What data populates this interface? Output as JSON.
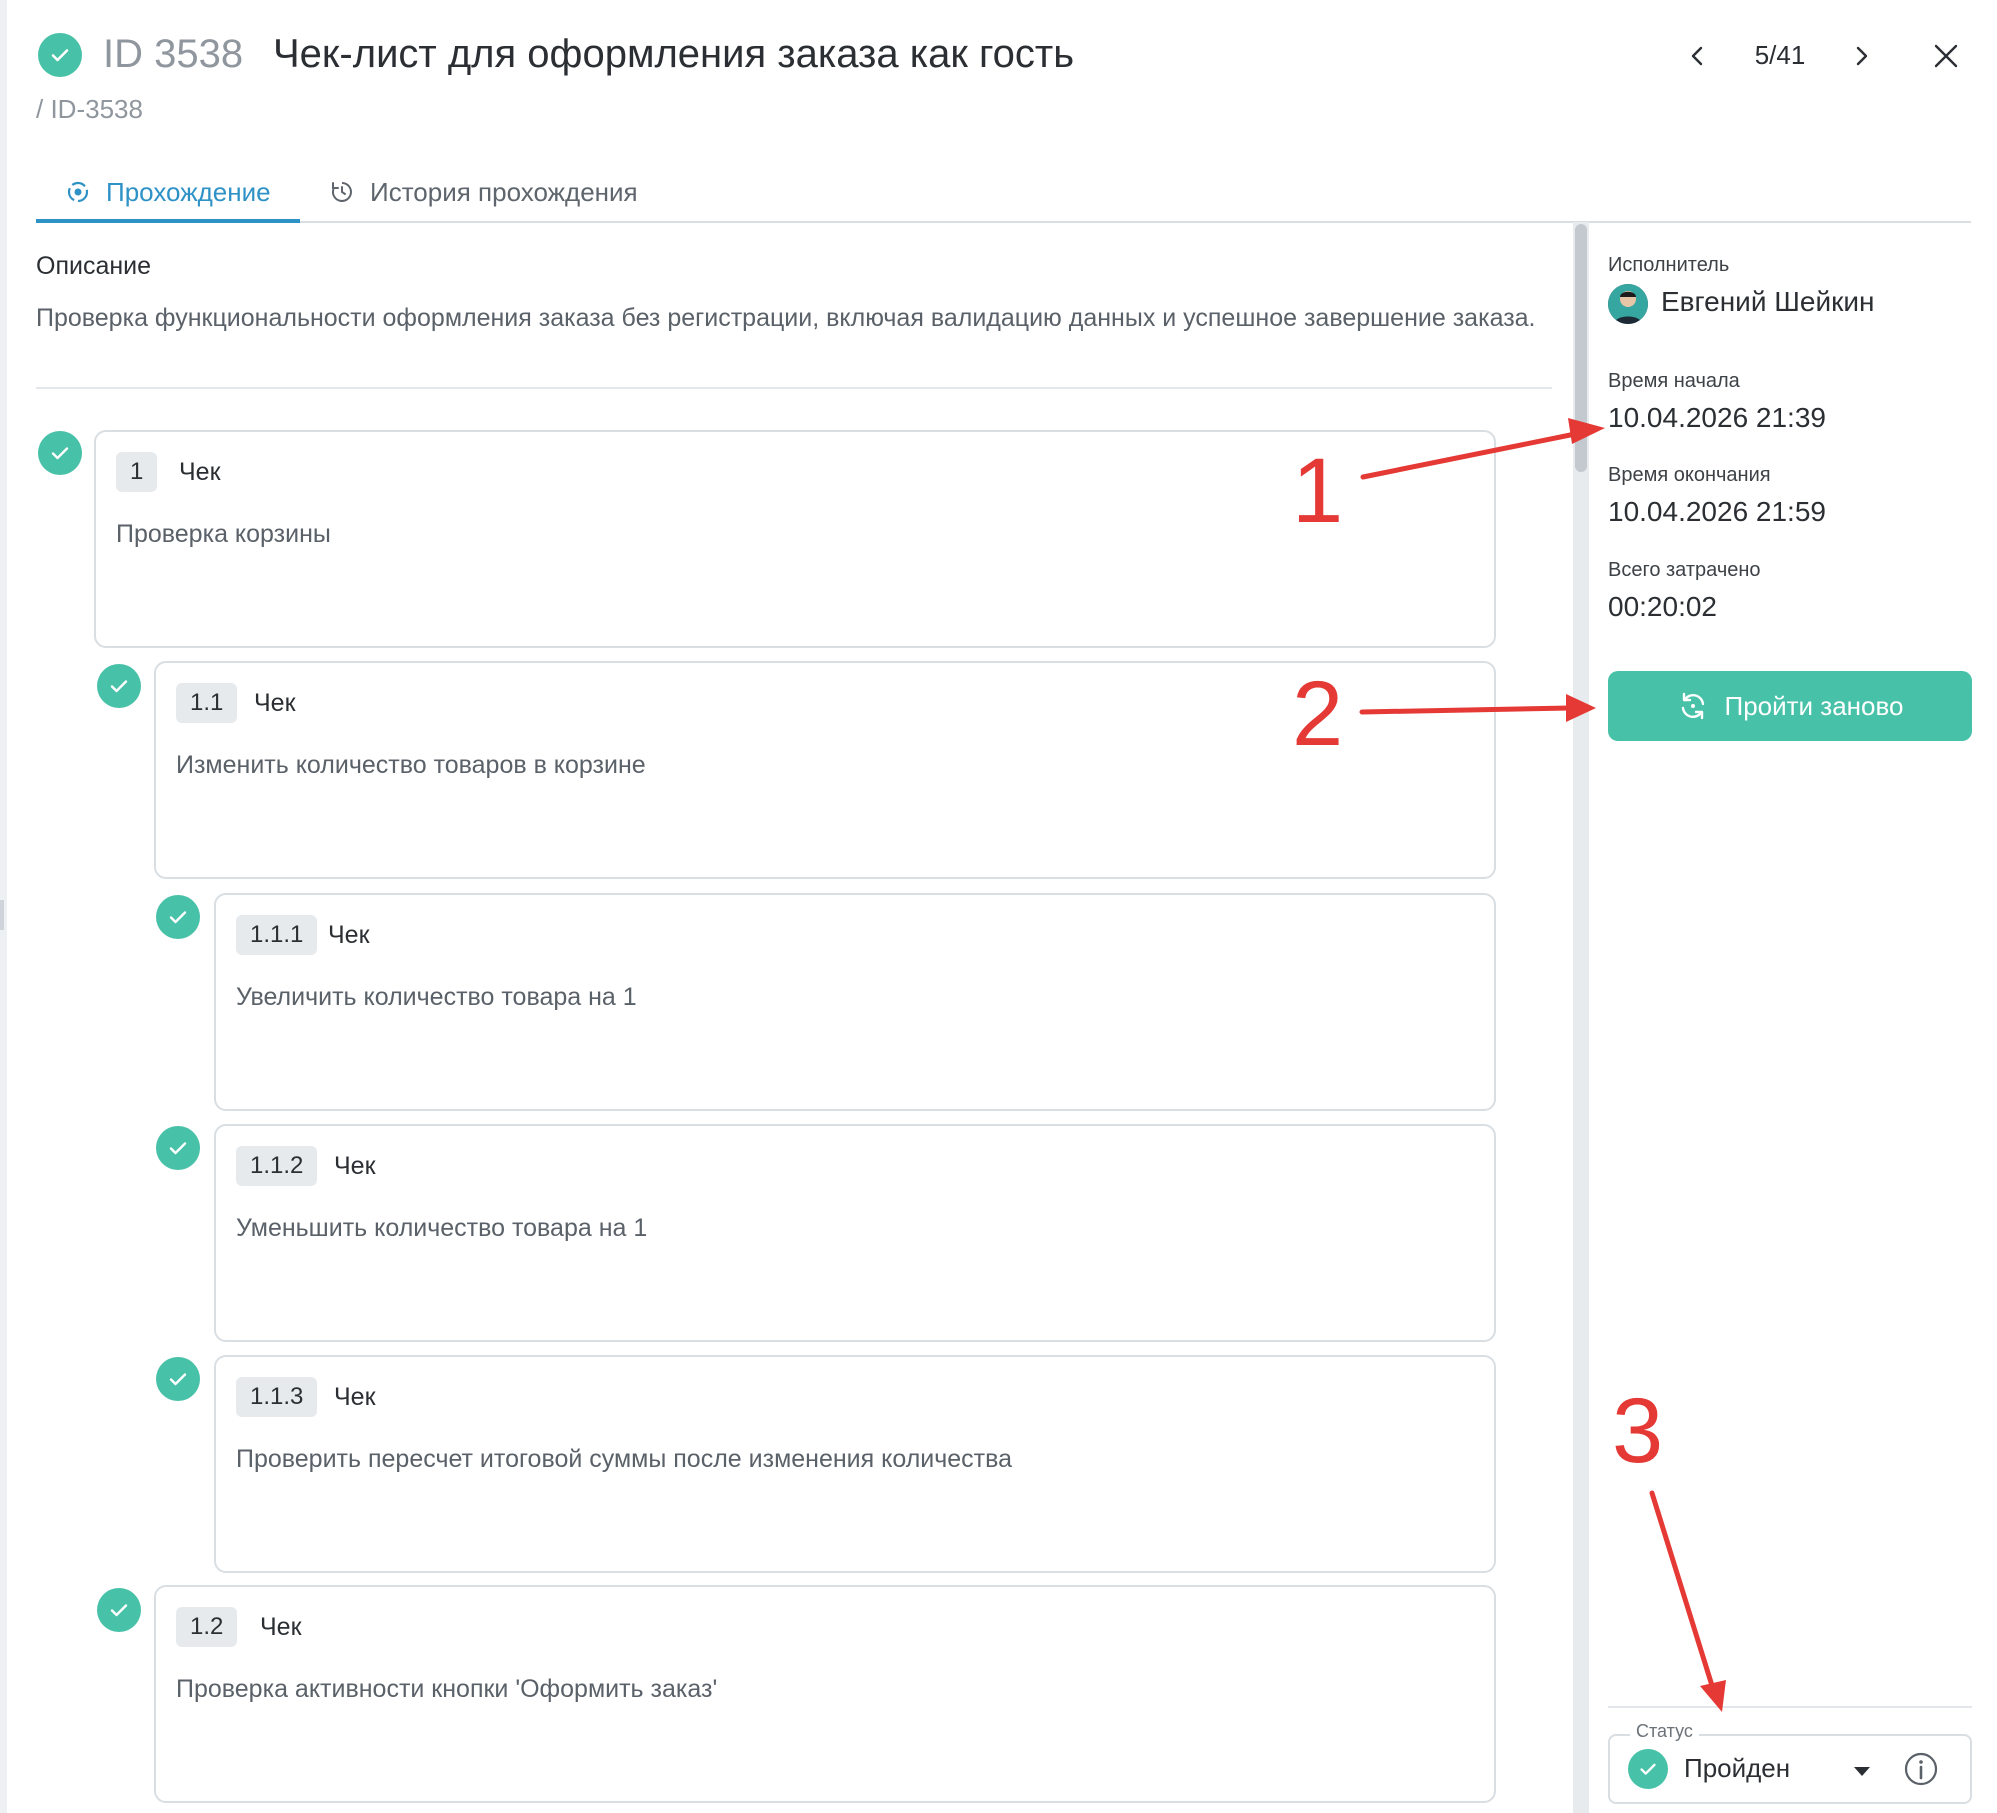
{
  "header": {
    "id": "ID 3538",
    "title": "Чек-лист для оформления заказа как гость",
    "breadcrumb": "/ ID-3538",
    "counter": "5/41"
  },
  "tabs": [
    {
      "label": "Прохождение",
      "icon": "run-icon",
      "active": true
    },
    {
      "label": "История прохождения",
      "icon": "history-icon",
      "active": false
    }
  ],
  "description": {
    "label": "Описание",
    "text": "Проверка функциональности оформления заказа без регистрации, включая валидацию данных и успешное завершение заказа."
  },
  "steps": [
    {
      "num": "1",
      "kind": "Чек",
      "text": "Проверка корзины",
      "status": "passed"
    },
    {
      "num": "1.1",
      "kind": "Чек",
      "text": "Изменить количество товаров в корзине",
      "status": "passed"
    },
    {
      "num": "1.1.1",
      "kind": "Чек",
      "text": "Увеличить количество товара на 1",
      "status": "passed"
    },
    {
      "num": "1.1.2",
      "kind": "Чек",
      "text": "Уменьшить количество товара на 1",
      "status": "passed"
    },
    {
      "num": "1.1.3",
      "kind": "Чек",
      "text": "Проверить пересчет итоговой суммы после изменения количества",
      "status": "passed"
    },
    {
      "num": "1.2",
      "kind": "Чек",
      "text": "Проверка активности кнопки 'Оформить заказ'",
      "status": "passed"
    }
  ],
  "panel": {
    "assignee_label": "Исполнитель",
    "assignee_name": "Евгений Шейкин",
    "start_label": "Время начала",
    "start_value": "10.04.2026 21:39",
    "end_label": "Время окончания",
    "end_value": "10.04.2026 21:59",
    "total_label": "Всего затрачено",
    "total_value": "00:20:02",
    "retry_label": "Пройти заново",
    "status_legend": "Статус",
    "status_value": "Пройден"
  },
  "annotations": [
    "1",
    "2",
    "3"
  ],
  "colors": {
    "accent": "#47c1a8",
    "tab_active": "#2f92c6",
    "annotation": "#e53935"
  }
}
